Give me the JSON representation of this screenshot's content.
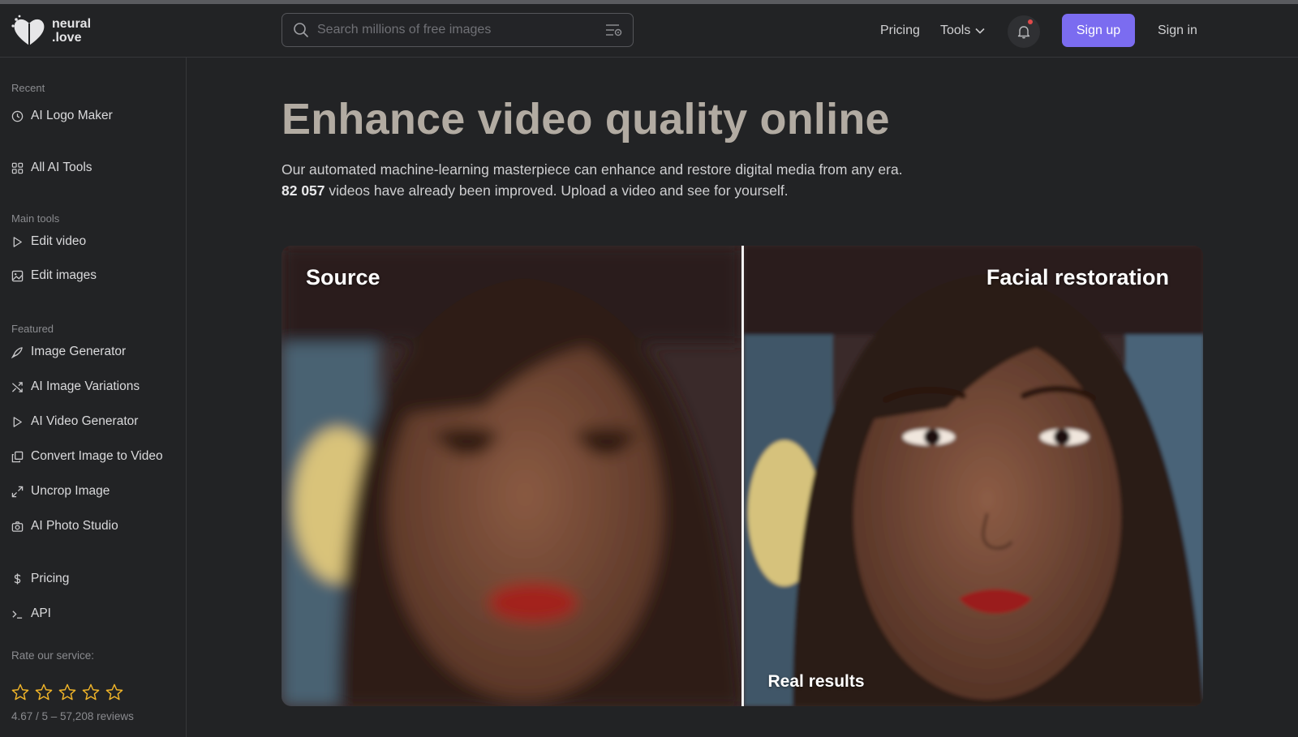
{
  "brand": {
    "line1": "neural",
    "line2": ".love"
  },
  "search": {
    "placeholder": "Search millions of free images"
  },
  "nav": {
    "pricing": "Pricing",
    "tools": "Tools",
    "sign_up": "Sign up",
    "sign_in": "Sign in"
  },
  "sidebar": {
    "recent_label": "Recent",
    "recent_items": [
      {
        "label": "AI Logo Maker",
        "icon": "clock-icon"
      }
    ],
    "all_tools": {
      "label": "All AI Tools",
      "icon": "grid-icon"
    },
    "main_tools_label": "Main tools",
    "main_tools": [
      {
        "label": "Edit video",
        "icon": "play-icon"
      },
      {
        "label": "Edit images",
        "icon": "image-icon"
      }
    ],
    "featured_label": "Featured",
    "featured": [
      {
        "label": "Image Generator",
        "icon": "brush-icon"
      },
      {
        "label": "AI Image Variations",
        "icon": "shuffle-icon"
      },
      {
        "label": "AI Video Generator",
        "icon": "play-icon"
      },
      {
        "label": "Convert Image to Video",
        "icon": "layers-icon"
      },
      {
        "label": "Uncrop Image",
        "icon": "expand-icon"
      },
      {
        "label": "AI Photo Studio",
        "icon": "camera-icon"
      }
    ],
    "bottom": [
      {
        "label": "Pricing",
        "icon": "dollar-icon"
      },
      {
        "label": "API",
        "icon": "terminal-icon"
      }
    ],
    "rate_label": "Rate our service:",
    "rating_text": "4.67 / 5 – 57,208 reviews",
    "star_count": 5
  },
  "main": {
    "title": "Enhance video quality online",
    "desc_line1": "Our automated machine-learning masterpiece can enhance and restore digital media from any era.",
    "count": "82 057",
    "desc_line2": " videos have already been improved. Upload a video and see for yourself.",
    "compare": {
      "left_label": "Source",
      "right_label": "Facial restoration",
      "footer_label": "Real results"
    }
  },
  "colors": {
    "accent": "#7b6cf0",
    "background": "#222325",
    "title": "#b2aba2",
    "notification_dot": "#e04a4a"
  }
}
